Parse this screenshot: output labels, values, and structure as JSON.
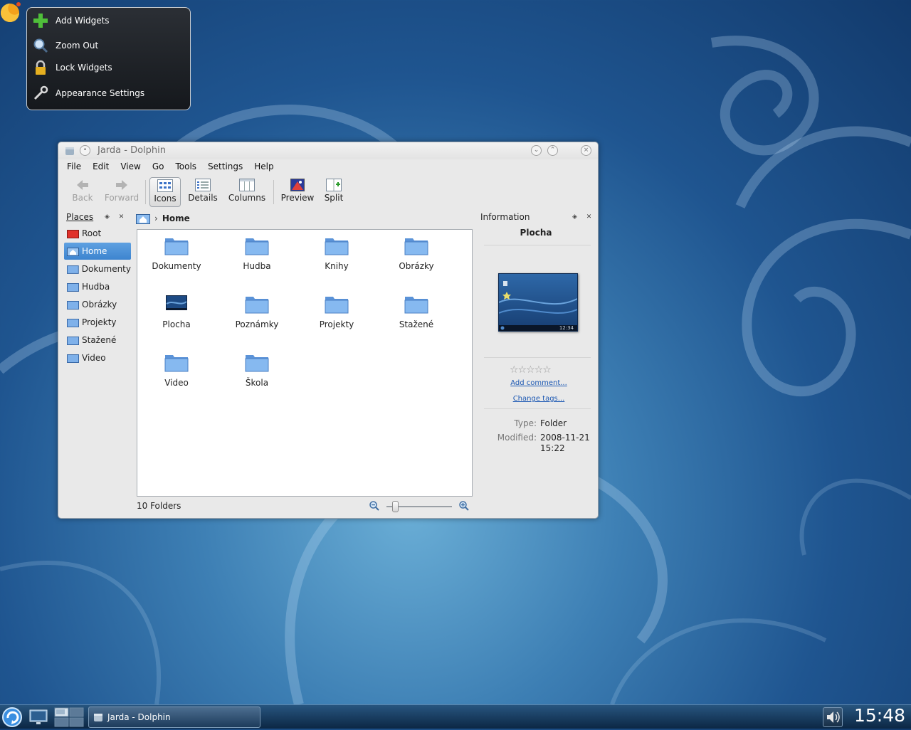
{
  "toolbox": {
    "items": [
      {
        "label": "Add Widgets",
        "icon": "add-icon"
      },
      {
        "label": "Zoom Out",
        "icon": "zoom-out-icon"
      },
      {
        "label": "Lock Widgets",
        "icon": "lock-icon"
      },
      {
        "label": "Appearance Settings",
        "icon": "wrench-icon"
      }
    ]
  },
  "window": {
    "title": "Jarda - Dolphin",
    "menu": [
      "File",
      "Edit",
      "View",
      "Go",
      "Tools",
      "Settings",
      "Help"
    ],
    "toolbar": {
      "back": "Back",
      "forward": "Forward",
      "icons": "Icons",
      "details": "Details",
      "columns": "Columns",
      "preview": "Preview",
      "split": "Split"
    },
    "places": {
      "title": "Places",
      "items": [
        "Root",
        "Home",
        "Dokumenty",
        "Hudba",
        "Obrázky",
        "Projekty",
        "Stažené",
        "Video"
      ],
      "selected": "Home"
    },
    "location": "Home",
    "files": [
      "Dokumenty",
      "Hudba",
      "Knihy",
      "Obrázky",
      "Plocha",
      "Poznámky",
      "Projekty",
      "Stažené",
      "Video",
      "Škola"
    ],
    "status": "10 Folders",
    "info": {
      "title": "Information",
      "name": "Plocha",
      "preview_clock": "12:34",
      "rating": 0,
      "add_comment": "Add comment...",
      "change_tags": "Change tags...",
      "type_label": "Type:",
      "type_value": "Folder",
      "modified_label": "Modified:",
      "modified_date": "2008-11-21",
      "modified_time": "15:22"
    }
  },
  "taskbar": {
    "task": "Jarda - Dolphin",
    "clock": "15:48"
  },
  "colors": {
    "selection": "#3d84cf",
    "folder": "#6fa6e6",
    "panel": "#0c2744"
  }
}
